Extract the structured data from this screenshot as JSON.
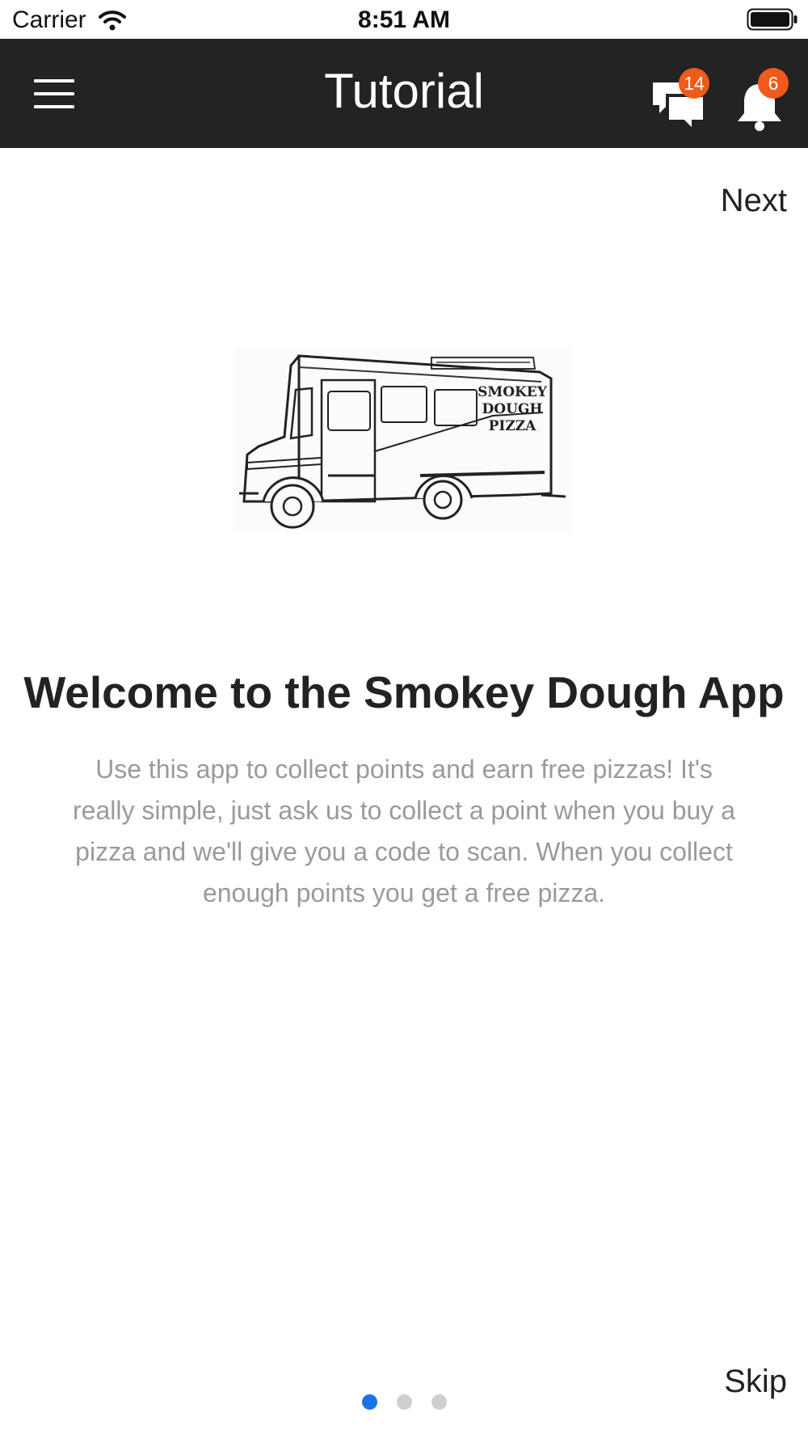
{
  "status_bar": {
    "carrier": "Carrier",
    "time": "8:51 AM"
  },
  "nav": {
    "title": "Tutorial",
    "chat_badge": "14",
    "notification_badge": "6",
    "icons": [
      "menu-icon",
      "chat-icon",
      "bell-icon"
    ]
  },
  "tutorial": {
    "next_label": "Next",
    "skip_label": "Skip",
    "image_text": [
      "SMOKEY",
      "DOUGH",
      "PIZZA"
    ],
    "title": "Welcome to the Smokey Dough App",
    "body": "Use this app to collect points and earn free pizzas! It's really simple, just ask us to collect a point when you buy a pizza and we'll give you a code to scan. When you collect enough points you get a free pizza.",
    "page_count": 3,
    "current_page": 1
  },
  "colors": {
    "nav_background": "#232323",
    "badge": "#f05a1a",
    "active_dot": "#1a73e8",
    "inactive_dot": "#cfcfcf",
    "body_text": "#9a9a9a"
  }
}
